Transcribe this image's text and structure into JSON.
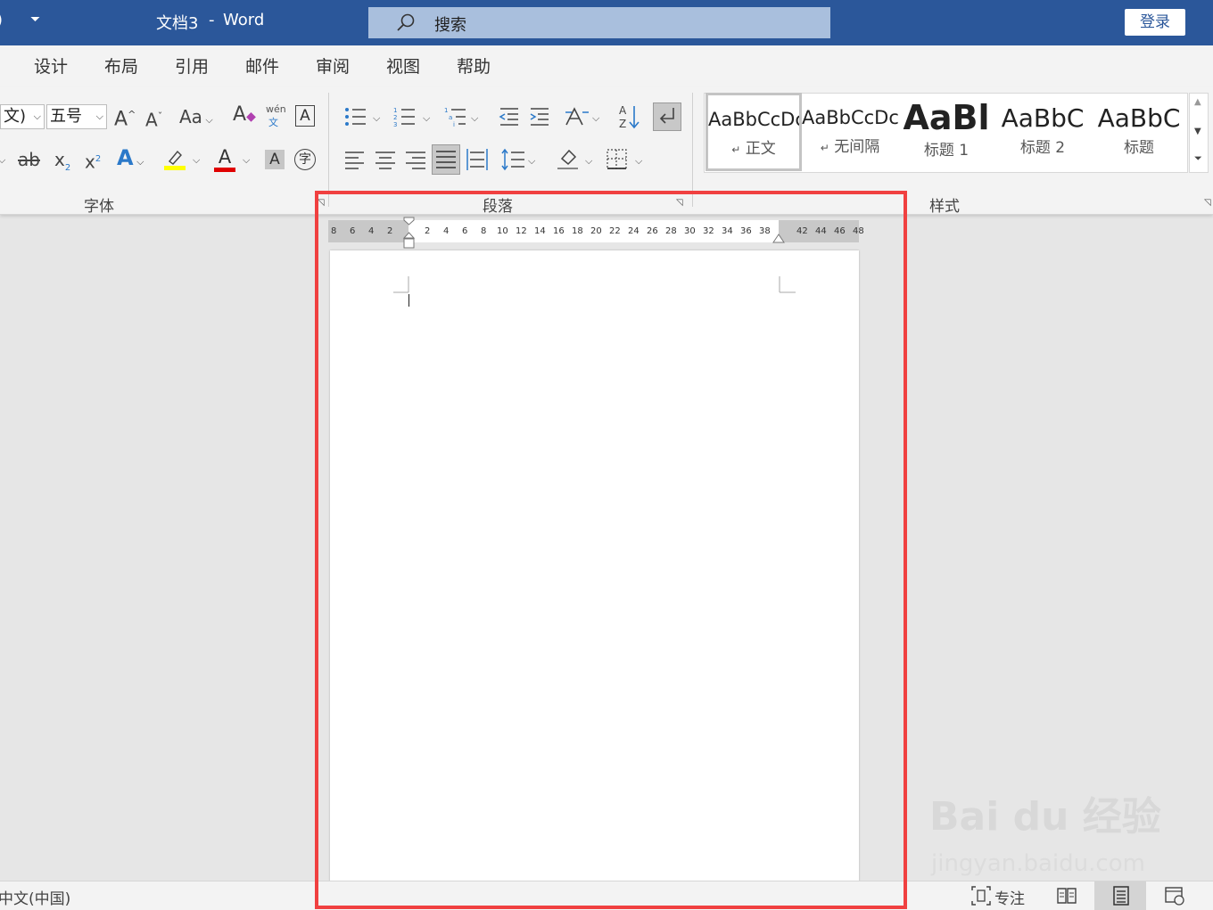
{
  "title": {
    "doc_name": "文档3",
    "separator": "-",
    "app": "Word"
  },
  "search": {
    "placeholder": "搜索"
  },
  "login_label": "登录",
  "tabs": [
    "设计",
    "布局",
    "引用",
    "邮件",
    "审阅",
    "视图",
    "帮助"
  ],
  "font": {
    "name_fragment": "文)",
    "size": "五号",
    "grow": "A",
    "shrink": "A",
    "case": "Aa",
    "phonetic_top": "wén",
    "phonetic_bottom": "文",
    "border_char": "A",
    "strike": "ab",
    "sub": "x",
    "sub_mark": "2",
    "sup": "x",
    "sup_mark": "2",
    "effects": "A",
    "color_a": "A",
    "shade_a": "A",
    "circle_char": "字",
    "highlight_color": "#ffff00",
    "font_color": "#e00000"
  },
  "groups": {
    "font": "字体",
    "paragraph": "段落",
    "styles": "样式"
  },
  "styles": [
    {
      "sample": "AaBbCcDc",
      "name": "正文",
      "mark": "↵"
    },
    {
      "sample": "AaBbCcDc",
      "name": "无间隔",
      "mark": "↵"
    },
    {
      "sample": "AaBl",
      "name": "标题 1",
      "mark": ""
    },
    {
      "sample": "AaBbC",
      "name": "标题 2",
      "mark": ""
    },
    {
      "sample": "AaBbC",
      "name": "标题",
      "mark": ""
    }
  ],
  "ruler": {
    "left": [
      "8",
      "6",
      "4",
      "2"
    ],
    "main": [
      "2",
      "4",
      "6",
      "8",
      "10",
      "12",
      "14",
      "16",
      "18",
      "20",
      "22",
      "24",
      "26",
      "28",
      "30",
      "32",
      "34",
      "36",
      "38"
    ],
    "right": [
      "42",
      "44",
      "46",
      "48"
    ]
  },
  "status": {
    "language": "中文(中国)",
    "focus": "专注"
  },
  "watermark": {
    "line1": "Bai du 经验",
    "line2": "jingyan.baidu.com"
  },
  "colors": {
    "title_bar": "#2b579a",
    "highlight_box": "#f04040"
  }
}
